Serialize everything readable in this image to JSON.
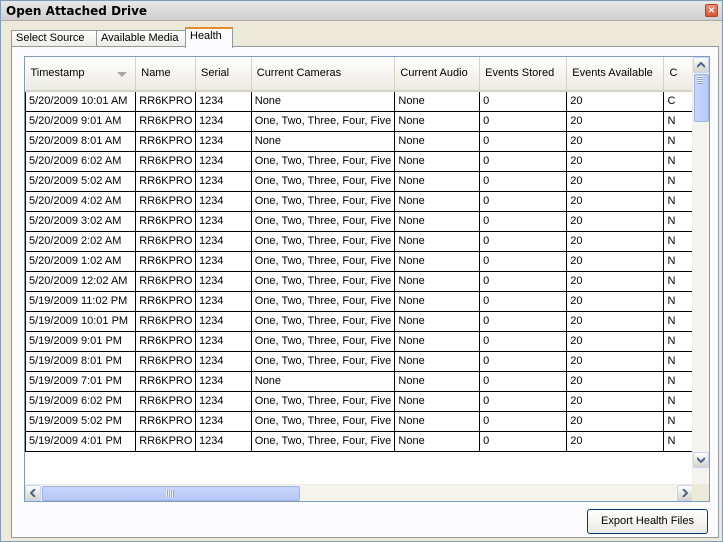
{
  "window": {
    "title": "Open Attached Drive",
    "close_glyph": "×"
  },
  "tabs": [
    {
      "label": "Select Source"
    },
    {
      "label": "Available Media"
    },
    {
      "label": "Health"
    }
  ],
  "grid": {
    "columns": [
      {
        "label": "Timestamp",
        "sorted": true
      },
      {
        "label": "Name"
      },
      {
        "label": "Serial"
      },
      {
        "label": "Current Cameras"
      },
      {
        "label": "Current Audio"
      },
      {
        "label": "Events Stored"
      },
      {
        "label": "Events Available"
      },
      {
        "label": "C"
      }
    ],
    "rows": [
      [
        "5/20/2009 10:01 AM",
        "RR6KPRO",
        "1234",
        "None",
        "None",
        "0",
        "20",
        "C"
      ],
      [
        "5/20/2009 9:01 AM",
        "RR6KPRO",
        "1234",
        "One, Two, Three, Four, Five",
        "None",
        "0",
        "20",
        "N"
      ],
      [
        "5/20/2009 8:01 AM",
        "RR6KPRO",
        "1234",
        "None",
        "None",
        "0",
        "20",
        "N"
      ],
      [
        "5/20/2009 6:02 AM",
        "RR6KPRO",
        "1234",
        "One, Two, Three, Four, Five",
        "None",
        "0",
        "20",
        "N"
      ],
      [
        "5/20/2009 5:02 AM",
        "RR6KPRO",
        "1234",
        "One, Two, Three, Four, Five",
        "None",
        "0",
        "20",
        "N"
      ],
      [
        "5/20/2009 4:02 AM",
        "RR6KPRO",
        "1234",
        "One, Two, Three, Four, Five",
        "None",
        "0",
        "20",
        "N"
      ],
      [
        "5/20/2009 3:02 AM",
        "RR6KPRO",
        "1234",
        "One, Two, Three, Four, Five",
        "None",
        "0",
        "20",
        "N"
      ],
      [
        "5/20/2009 2:02 AM",
        "RR6KPRO",
        "1234",
        "One, Two, Three, Four, Five",
        "None",
        "0",
        "20",
        "N"
      ],
      [
        "5/20/2009 1:02 AM",
        "RR6KPRO",
        "1234",
        "One, Two, Three, Four, Five",
        "None",
        "0",
        "20",
        "N"
      ],
      [
        "5/20/2009 12:02 AM",
        "RR6KPRO",
        "1234",
        "One, Two, Three, Four, Five",
        "None",
        "0",
        "20",
        "N"
      ],
      [
        "5/19/2009 11:02 PM",
        "RR6KPRO",
        "1234",
        "One, Two, Three, Four, Five",
        "None",
        "0",
        "20",
        "N"
      ],
      [
        "5/19/2009 10:01 PM",
        "RR6KPRO",
        "1234",
        "One, Two, Three, Four, Five",
        "None",
        "0",
        "20",
        "N"
      ],
      [
        "5/19/2009 9:01 PM",
        "RR6KPRO",
        "1234",
        "One, Two, Three, Four, Five",
        "None",
        "0",
        "20",
        "N"
      ],
      [
        "5/19/2009 8:01 PM",
        "RR6KPRO",
        "1234",
        "One, Two, Three, Four, Five",
        "None",
        "0",
        "20",
        "N"
      ],
      [
        "5/19/2009 7:01 PM",
        "RR6KPRO",
        "1234",
        "None",
        "None",
        "0",
        "20",
        "N"
      ],
      [
        "5/19/2009 6:02 PM",
        "RR6KPRO",
        "1234",
        "One, Two, Three, Four, Five",
        "None",
        "0",
        "20",
        "N"
      ],
      [
        "5/19/2009 5:02 PM",
        "RR6KPRO",
        "1234",
        "One, Two, Three, Four, Five",
        "None",
        "0",
        "20",
        "N"
      ],
      [
        "5/19/2009 4:01 PM",
        "RR6KPRO",
        "1234",
        "One, Two, Three, Four, Five",
        "None",
        "0",
        "20",
        "N"
      ]
    ]
  },
  "scrollbars": {
    "vertical": {
      "up": "chevron-up-icon",
      "down": "chevron-down-icon"
    },
    "horizontal": {
      "left": "chevron-left-icon",
      "right": "chevron-right-icon"
    }
  },
  "actions": {
    "export_label": "Export Health Files"
  },
  "colors": {
    "active_tab_accent": "#e68b2c",
    "window_bg": "#ece9d8",
    "close_button": "#d9542f"
  }
}
